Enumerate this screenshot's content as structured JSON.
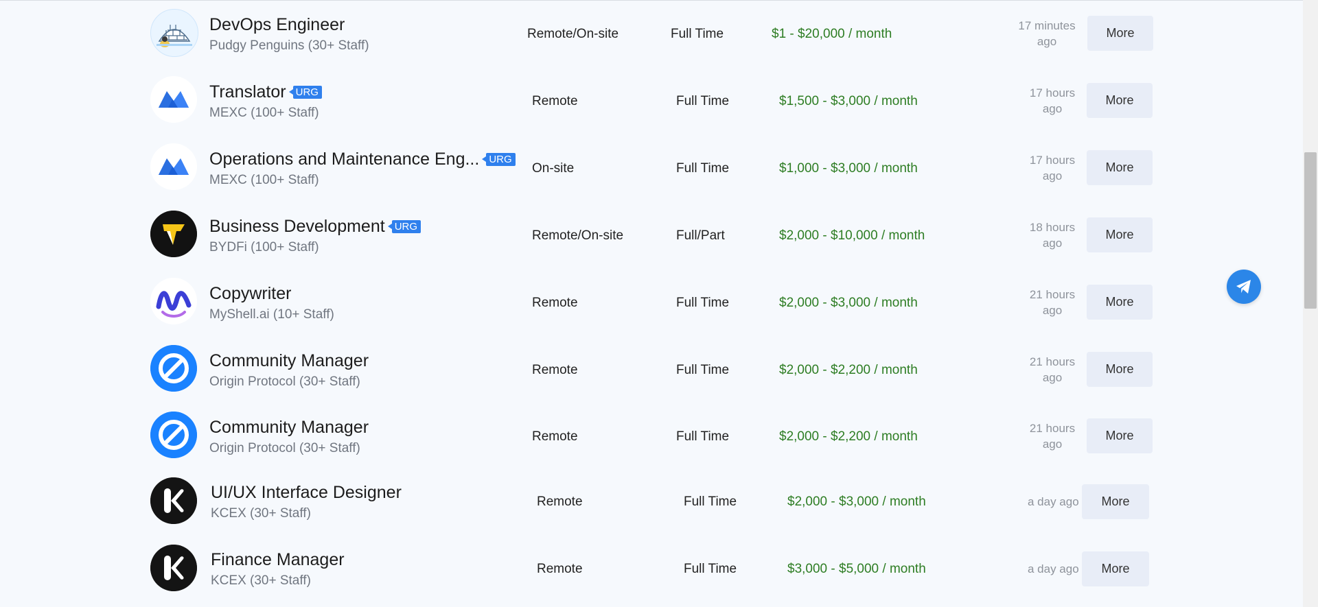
{
  "jobs": [
    {
      "title": "DevOps Engineer",
      "urgent": false,
      "company": "Pudgy Penguins (30+ Staff)",
      "location": "Remote/On-site",
      "type": "Full Time",
      "salary": "$1 - $20,000 / month",
      "time_line1": "17 minutes",
      "time_line2": "ago",
      "more_label": "More",
      "logo_icon": "pudgy-penguins-igloo-icon"
    },
    {
      "title": "Translator",
      "urgent": true,
      "urgent_label": "URG",
      "company": "MEXC (100+ Staff)",
      "location": "Remote",
      "type": "Full Time",
      "salary": "$1,500 - $3,000 / month",
      "time_line1": "17 hours",
      "time_line2": "ago",
      "more_label": "More",
      "logo_icon": "mexc-logo-icon"
    },
    {
      "title": "Operations and Maintenance Eng...",
      "urgent": true,
      "urgent_label": "URG",
      "company": "MEXC (100+ Staff)",
      "location": "On-site",
      "type": "Full Time",
      "salary": "$1,000 - $3,000 / month",
      "time_line1": "17 hours",
      "time_line2": "ago",
      "more_label": "More",
      "logo_icon": "mexc-logo-icon"
    },
    {
      "title": "Business Development",
      "urgent": true,
      "urgent_label": "URG",
      "company": "BYDFi (100+ Staff)",
      "location": "Remote/On-site",
      "type": "Full/Part",
      "salary": "$2,000 - $10,000 / month",
      "time_line1": "18 hours",
      "time_line2": "ago",
      "more_label": "More",
      "logo_icon": "bydfi-logo-icon"
    },
    {
      "title": "Copywriter",
      "urgent": false,
      "company": "MyShell.ai (10+ Staff)",
      "location": "Remote",
      "type": "Full Time",
      "salary": "$2,000 - $3,000 / month",
      "time_line1": "21 hours",
      "time_line2": "ago",
      "more_label": "More",
      "logo_icon": "myshell-logo-icon"
    },
    {
      "title": "Community Manager",
      "urgent": false,
      "company": "Origin Protocol (30+ Staff)",
      "location": "Remote",
      "type": "Full Time",
      "salary": "$2,000 - $2,200 / month",
      "time_line1": "21 hours",
      "time_line2": "ago",
      "more_label": "More",
      "logo_icon": "origin-protocol-logo-icon"
    },
    {
      "title": "Community Manager",
      "urgent": false,
      "company": "Origin Protocol (30+ Staff)",
      "location": "Remote",
      "type": "Full Time",
      "salary": "$2,000 - $2,200 / month",
      "time_line1": "21 hours",
      "time_line2": "ago",
      "more_label": "More",
      "logo_icon": "origin-protocol-logo-icon"
    },
    {
      "title": "UI/UX Interface Designer",
      "urgent": false,
      "company": "KCEX (30+ Staff)",
      "location": "Remote",
      "type": "Full Time",
      "salary": "$2,000 - $3,000 / month",
      "time_line1": "a day ago",
      "time_line2": "",
      "more_label": "More",
      "logo_icon": "kcex-logo-icon"
    },
    {
      "title": "Finance Manager",
      "urgent": false,
      "company": "KCEX (30+ Staff)",
      "location": "Remote",
      "type": "Full Time",
      "salary": "$3,000 - $5,000 / month",
      "time_line1": "a day ago",
      "time_line2": "",
      "more_label": "More",
      "logo_icon": "kcex-logo-icon"
    }
  ],
  "floating_button": {
    "icon": "telegram-icon",
    "color": "#2b86e8"
  },
  "colors": {
    "salary": "#2d7d23",
    "urgent_badge": "#2f80ed",
    "more_button_bg": "#e8edf7",
    "background": "#f6f9fd"
  }
}
